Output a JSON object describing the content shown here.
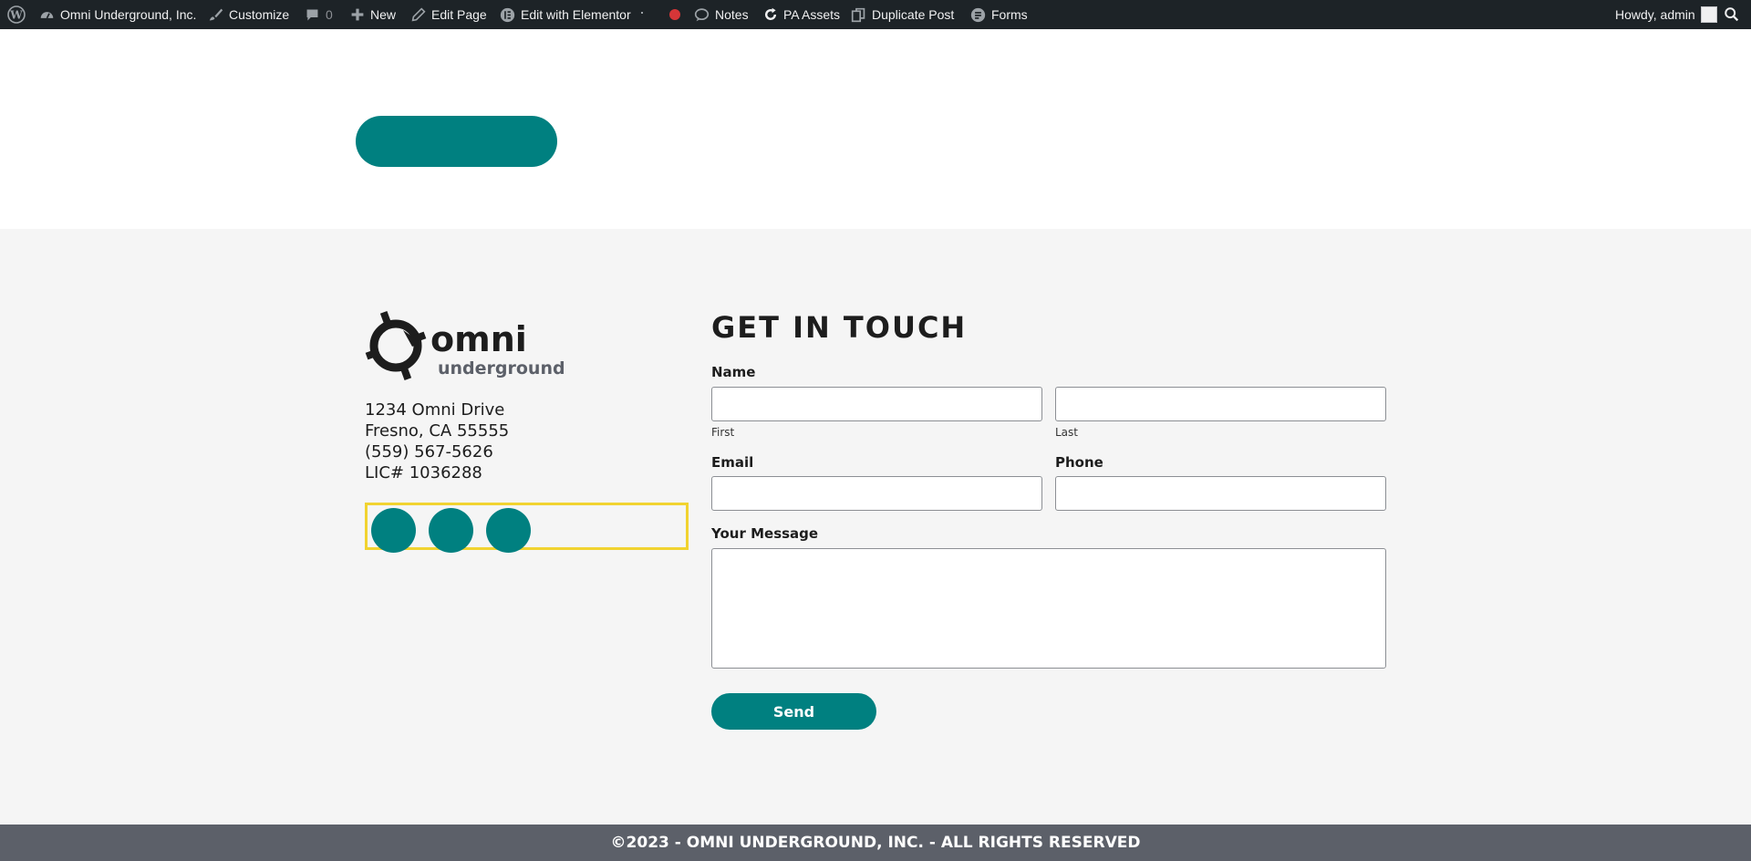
{
  "admin_bar": {
    "site_name": "Omni Underground, Inc.",
    "customize": "Customize",
    "comments_count": "0",
    "new": "New",
    "edit_page": "Edit Page",
    "edit_elementor": "Edit with Elementor",
    "notes": "Notes",
    "pa_assets": "PA Assets",
    "duplicate_post": "Duplicate Post",
    "forms": "Forms",
    "howdy": "Howdy, admin"
  },
  "logo": {
    "wordmark_top": "omni",
    "wordmark_bottom": "underground"
  },
  "address": {
    "street": "1234 Omni Drive",
    "city": "Fresno, CA 55555",
    "phone": "(559) 567-5626",
    "license": "LIC# 1036288"
  },
  "contact_form": {
    "heading": "GET IN TOUCH",
    "name_label": "Name",
    "first_label": "First",
    "last_label": "Last",
    "first_value": "",
    "last_value": "",
    "email_label": "Email",
    "email_value": "",
    "phone_label": "Phone",
    "phone_value": "",
    "message_label": "Your Message",
    "message_value": "",
    "send_label": "Send"
  },
  "footer": {
    "copyright": "©2023 - OMNI UNDERGROUND, INC. - ALL RIGHTS RESERVED"
  },
  "colors": {
    "accent_teal": "#008080",
    "highlight_yellow": "#f1d330",
    "admin_bar_bg": "#1d2327",
    "footer_bar_bg": "#5c6069"
  }
}
